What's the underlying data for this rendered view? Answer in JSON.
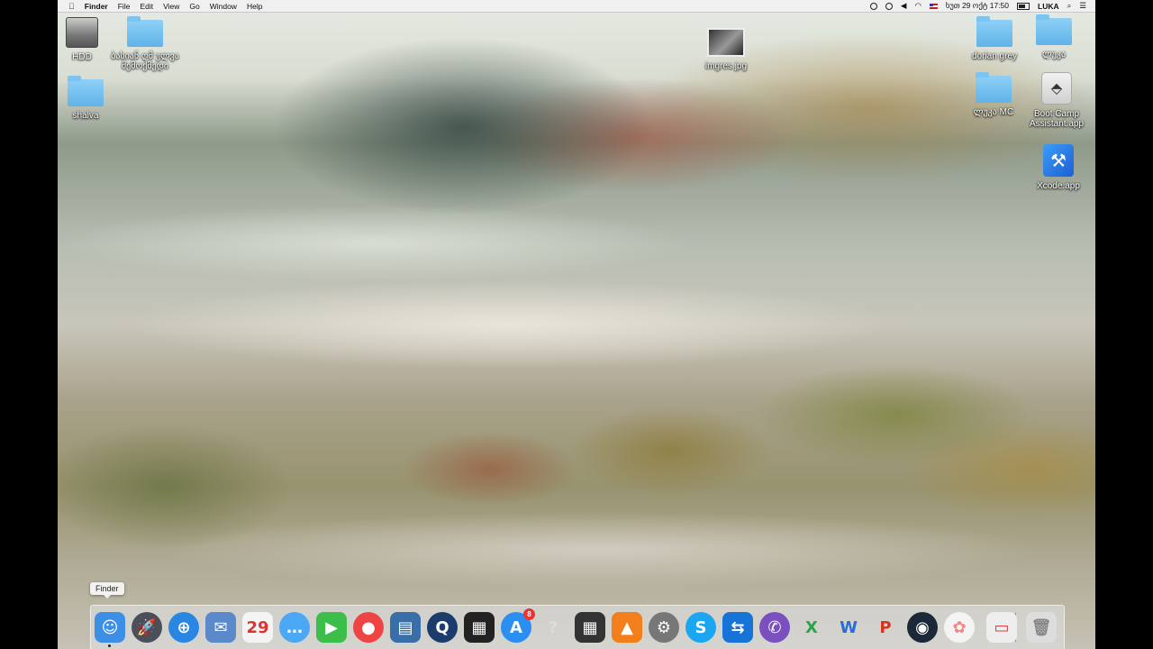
{
  "menubar": {
    "apple_icon": "apple-icon",
    "app_name": "Finder",
    "items": [
      "File",
      "Edit",
      "View",
      "Go",
      "Window",
      "Help"
    ],
    "clock": "ხუთ 29 ოქტ  17:50",
    "user": "LUKA",
    "status_icons": [
      "record-icon",
      "timemachine-icon",
      "volume-icon",
      "wifi-icon",
      "flag-icon",
      "battery-icon",
      "search-icon",
      "notification-center-icon"
    ]
  },
  "desktop": {
    "icons": [
      {
        "label": "HDD",
        "type": "hdd-icon"
      },
      {
        "label": "ბასიან ღმ ულვა შემოქმედი",
        "type": "folder-icon"
      },
      {
        "label": "shalva",
        "type": "folder-icon"
      },
      {
        "label": "imgres.jpg",
        "type": "image-thumbnail"
      },
      {
        "label": "dorian grey",
        "type": "folder-icon"
      },
      {
        "label": "ლუკა",
        "type": "folder-icon"
      },
      {
        "label": "ლუკა MC",
        "type": "folder-icon"
      },
      {
        "label": "Boot Camp Assistant.app",
        "type": "bootcamp-icon"
      },
      {
        "label": "Xcode.app",
        "type": "xcode-icon"
      }
    ]
  },
  "dock": {
    "tooltip": "Finder",
    "badge_count": "8",
    "apps": [
      {
        "name": "finder",
        "glyph": "☺",
        "color": "#3d8fe6"
      },
      {
        "name": "launchpad",
        "glyph": "🚀",
        "color": "#4a4f5a"
      },
      {
        "name": "safari",
        "glyph": "⊕",
        "color": "#2a86e3"
      },
      {
        "name": "preview",
        "glyph": "✉",
        "color": "#5c89c9"
      },
      {
        "name": "calendar",
        "glyph": "29",
        "color": "#f4f4f4"
      },
      {
        "name": "messages",
        "glyph": "…",
        "color": "#4aa8f5"
      },
      {
        "name": "facetime",
        "glyph": "▶",
        "color": "#3bbf4a"
      },
      {
        "name": "chrome",
        "glyph": "●",
        "color": "#e44"
      },
      {
        "name": "archive-utility",
        "glyph": "▤",
        "color": "#3a6ea8"
      },
      {
        "name": "quicktime",
        "glyph": "Q",
        "color": "#1c3d6b"
      },
      {
        "name": "final-cut",
        "glyph": "▦",
        "color": "#222"
      },
      {
        "name": "app-store",
        "glyph": "A",
        "color": "#2b8ff2"
      },
      {
        "name": "unknown-app",
        "glyph": "?",
        "color": "transparent"
      },
      {
        "name": "imovie",
        "glyph": "▦",
        "color": "#333"
      },
      {
        "name": "vlc",
        "glyph": "▲",
        "color": "#f27e1c"
      },
      {
        "name": "system-preferences",
        "glyph": "⚙",
        "color": "#777"
      },
      {
        "name": "skype",
        "glyph": "S",
        "color": "#1ba6f2"
      },
      {
        "name": "teamviewer",
        "glyph": "⇆",
        "color": "#1673d8"
      },
      {
        "name": "viber",
        "glyph": "✆",
        "color": "#7a4fbe"
      },
      {
        "name": "excel",
        "glyph": "X",
        "color": "transparent"
      },
      {
        "name": "word",
        "glyph": "W",
        "color": "transparent"
      },
      {
        "name": "powerpoint",
        "glyph": "P",
        "color": "transparent"
      },
      {
        "name": "steam",
        "glyph": "◉",
        "color": "#1b2838"
      },
      {
        "name": "photos",
        "glyph": "✿",
        "color": "#f4f4f4"
      },
      {
        "name": "downloads-stack",
        "glyph": "▭",
        "color": "#eee"
      },
      {
        "name": "trash",
        "glyph": "🗑",
        "color": "#ddd"
      }
    ]
  }
}
